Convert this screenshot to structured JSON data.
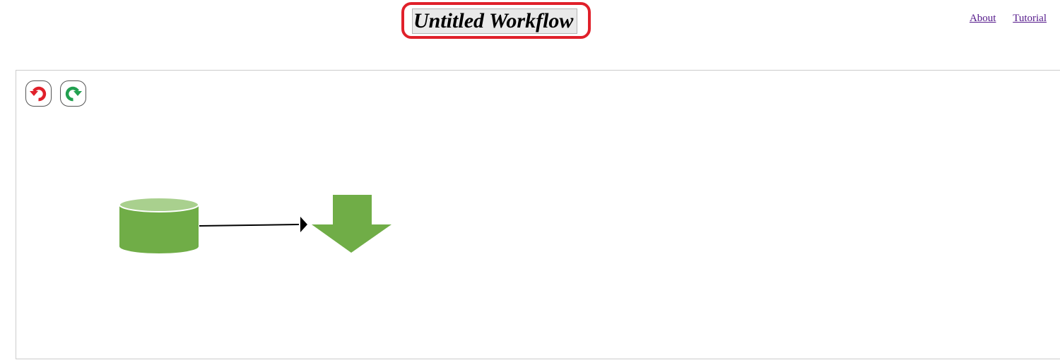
{
  "workflow": {
    "title": "Untitled Workflow"
  },
  "nav": {
    "about": "About",
    "tutorial": "Tutorial"
  },
  "toolbar": {
    "undo_icon": "undo-icon",
    "redo_icon": "redo-icon",
    "undo_color": "#e0202a",
    "redo_color": "#22a050"
  },
  "diagram": {
    "nodes": [
      {
        "type": "database",
        "icon": "database-icon",
        "color": "#70ad47"
      },
      {
        "type": "output",
        "icon": "down-arrow-icon",
        "color": "#70ad47"
      }
    ],
    "edges": [
      {
        "from": 0,
        "to": 1
      }
    ]
  }
}
